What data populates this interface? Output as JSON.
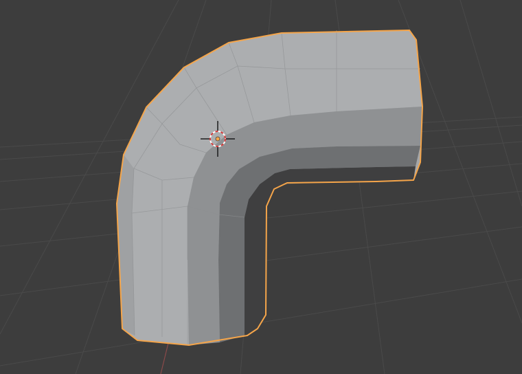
{
  "viewport": {
    "background_color": "#3d3d3d",
    "grid_color": "#4a4a4a",
    "y_axis_color": "#8a4a4a"
  },
  "object": {
    "selected": true,
    "selection_outline_color": "#f5a54a",
    "face_light_color": "#a9abad",
    "face_mid_color": "#939597",
    "face_dark_color": "#6e7072",
    "face_shadow_color": "#3e3e3f"
  },
  "cursor_3d": {
    "ring_color_primary": "#ffffff",
    "ring_color_secondary": "#d23a3a",
    "crosshair_color": "#111111"
  },
  "origin_point": {
    "color": "#f5a54a"
  }
}
